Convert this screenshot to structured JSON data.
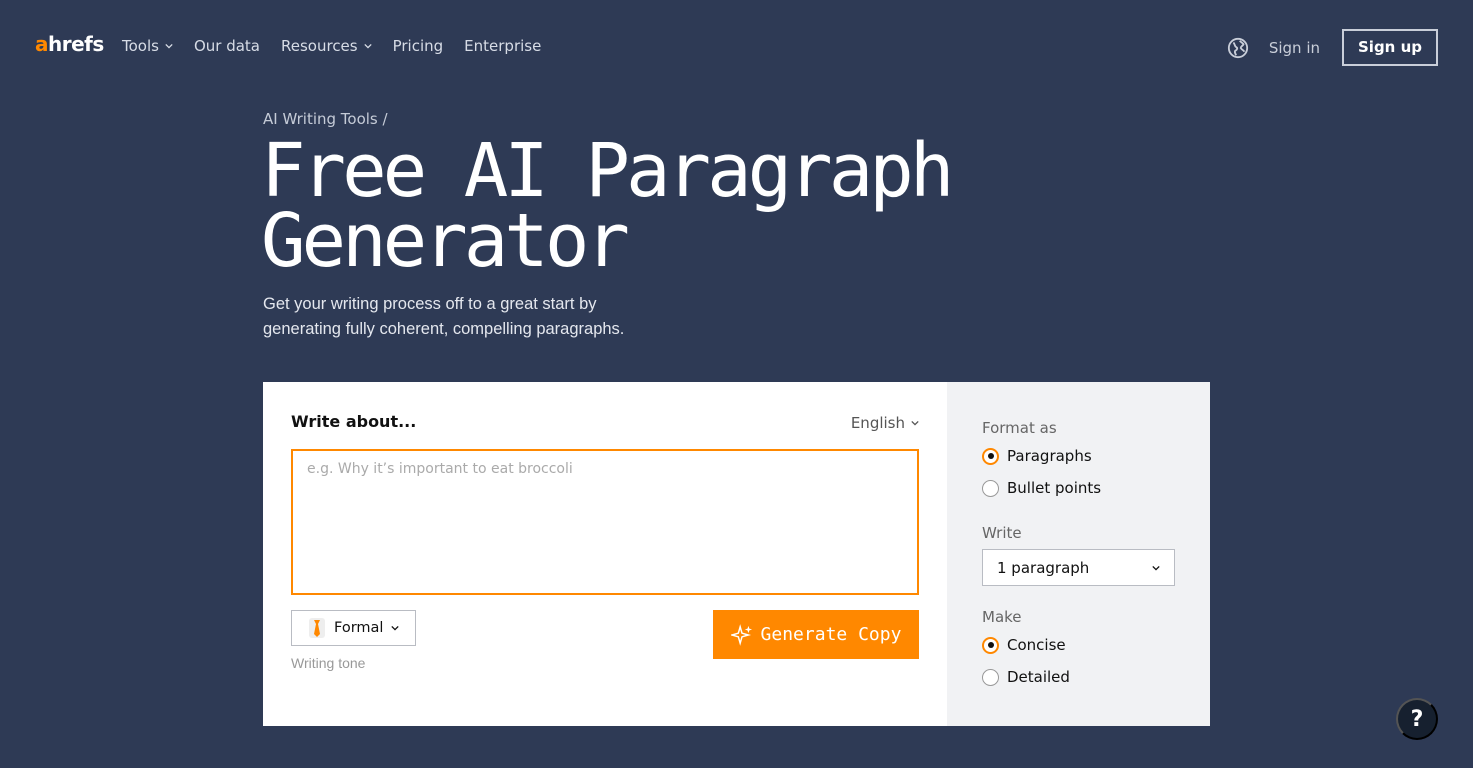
{
  "nav": {
    "logo_accent": "a",
    "logo_rest": "hrefs",
    "links": [
      {
        "label": "Tools",
        "dropdown": true
      },
      {
        "label": "Our data",
        "dropdown": false
      },
      {
        "label": "Resources",
        "dropdown": true
      },
      {
        "label": "Pricing",
        "dropdown": false
      },
      {
        "label": "Enterprise",
        "dropdown": false
      }
    ],
    "signin": "Sign in",
    "signup": "Sign up"
  },
  "hero": {
    "breadcrumb": "AI Writing Tools /",
    "title": "Free AI Paragraph Generator",
    "subtitle": "Get your writing process off to a great start by generating fully coherent, compelling paragraphs."
  },
  "form": {
    "write_label": "Write about...",
    "language": "English",
    "textarea_placeholder": "e.g. Why it’s important to eat broccoli",
    "tone_value": "Formal",
    "tone_label": "Writing tone",
    "generate_label": "Generate Copy"
  },
  "options": {
    "format_label": "Format as",
    "format_options": [
      {
        "label": "Paragraphs",
        "selected": true
      },
      {
        "label": "Bullet points",
        "selected": false
      }
    ],
    "write_label": "Write",
    "write_value": "1 paragraph",
    "make_label": "Make",
    "make_options": [
      {
        "label": "Concise",
        "selected": true
      },
      {
        "label": "Detailed",
        "selected": false
      }
    ]
  },
  "help_label": "?",
  "colors": {
    "background": "#2e3a55",
    "accent": "#ff8800",
    "card": "#ffffff",
    "panel": "#f1f2f4"
  }
}
